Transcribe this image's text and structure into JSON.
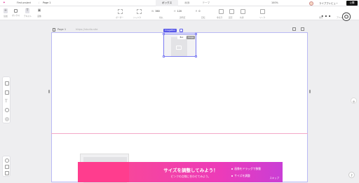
{
  "topbar": {
    "logo_icon": "studio-logo-icon",
    "project": "First project",
    "separator": "/",
    "page": "Page 1",
    "tabs": [
      "ボックス",
      "画面",
      "テーマ"
    ],
    "zoom": "100%",
    "preview": "ライブプレビュー",
    "publish": "公開"
  },
  "toolbar": {
    "tools": [
      {
        "icon": "add-icon",
        "label": "追加"
      },
      {
        "icon": "box-icon",
        "label": "ボックス"
      },
      {
        "icon": "text-icon",
        "label": "テキスト"
      },
      {
        "icon": "image-icon",
        "label": "画像"
      }
    ],
    "props": [
      {
        "key": "W",
        "value": "360"
      },
      {
        "key": "H",
        "value": "120"
      },
      {
        "key": "R",
        "value": "0"
      }
    ],
    "prop_labels": [
      "ボーダー",
      "シャドウ",
      "角丸",
      "透明度",
      "回転",
      "非表示",
      "固定",
      "共通",
      "リンク",
      "順序",
      "アニメーション"
    ]
  },
  "pagebar": {
    "name": "Page 1",
    "url": "https://studio.site"
  },
  "selection": {
    "tag": "ImageBox",
    "mini_menu": [
      "Box",
      "Image"
    ]
  },
  "banner": {
    "title": "サイズを調整してみよう！",
    "subtitle": "ピンクの点線に合わせてみよう。",
    "steps": [
      "画像をドラッグで移動",
      "サイズを調整"
    ],
    "skip": "スキップ"
  },
  "help": "?",
  "colors": {
    "accent": "#5858e8",
    "publish": "#111111",
    "banner_start": "#f7469c",
    "banner_end": "#c93ed6",
    "fold_line": "#f3a8c8"
  }
}
